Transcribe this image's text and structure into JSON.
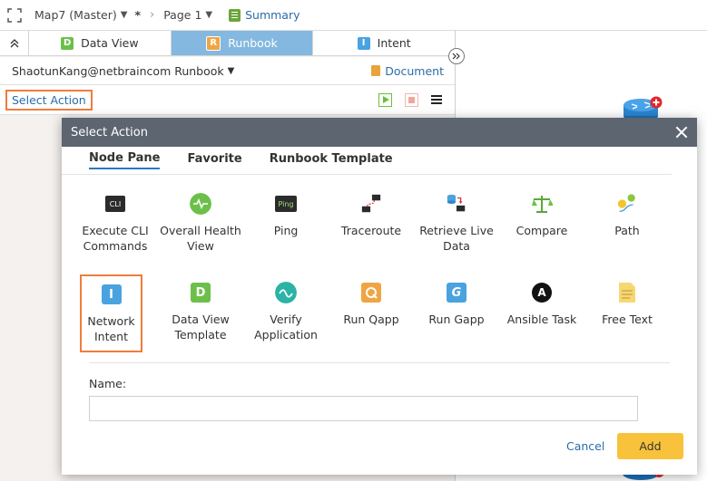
{
  "topbar": {
    "map": "Map7 (Master)",
    "unsaved_mark": "*",
    "page": "Page 1",
    "summary": "Summary"
  },
  "tabs": [
    {
      "label": "Data View",
      "icon": "D"
    },
    {
      "label": "Runbook",
      "icon": "R"
    },
    {
      "label": "Intent",
      "icon": "I"
    }
  ],
  "runbook": {
    "title": "ShaotunKang@netbraincom Runbook",
    "document_label": "Document",
    "select_action": "Select Action"
  },
  "modal": {
    "title": "Select Action",
    "tabs": [
      "Node Pane",
      "Favorite",
      "Runbook Template"
    ],
    "items": [
      {
        "label": "Execute CLI Commands",
        "icon_text": "CLI"
      },
      {
        "label": "Overall Health View"
      },
      {
        "label": "Ping",
        "icon_text": "Ping"
      },
      {
        "label": "Traceroute"
      },
      {
        "label": "Retrieve Live Data"
      },
      {
        "label": "Compare"
      },
      {
        "label": "Path"
      },
      {
        "label": "Network Intent",
        "icon_text": "I"
      },
      {
        "label": "Data View Template",
        "icon_text": "D"
      },
      {
        "label": "Verify Application"
      },
      {
        "label": "Run Qapp"
      },
      {
        "label": "Run Gapp",
        "icon_text": "G"
      },
      {
        "label": "Ansible Task",
        "icon_text": "A"
      },
      {
        "label": "Free Text"
      }
    ],
    "name_label": "Name:",
    "name_value": "",
    "cancel_label": "Cancel",
    "add_label": "Add"
  },
  "colors": {
    "accent_blue": "#2a6ca8",
    "selection_orange": "#ef7d3c",
    "add_button": "#f8c23b",
    "header_gray": "#5c6570"
  }
}
